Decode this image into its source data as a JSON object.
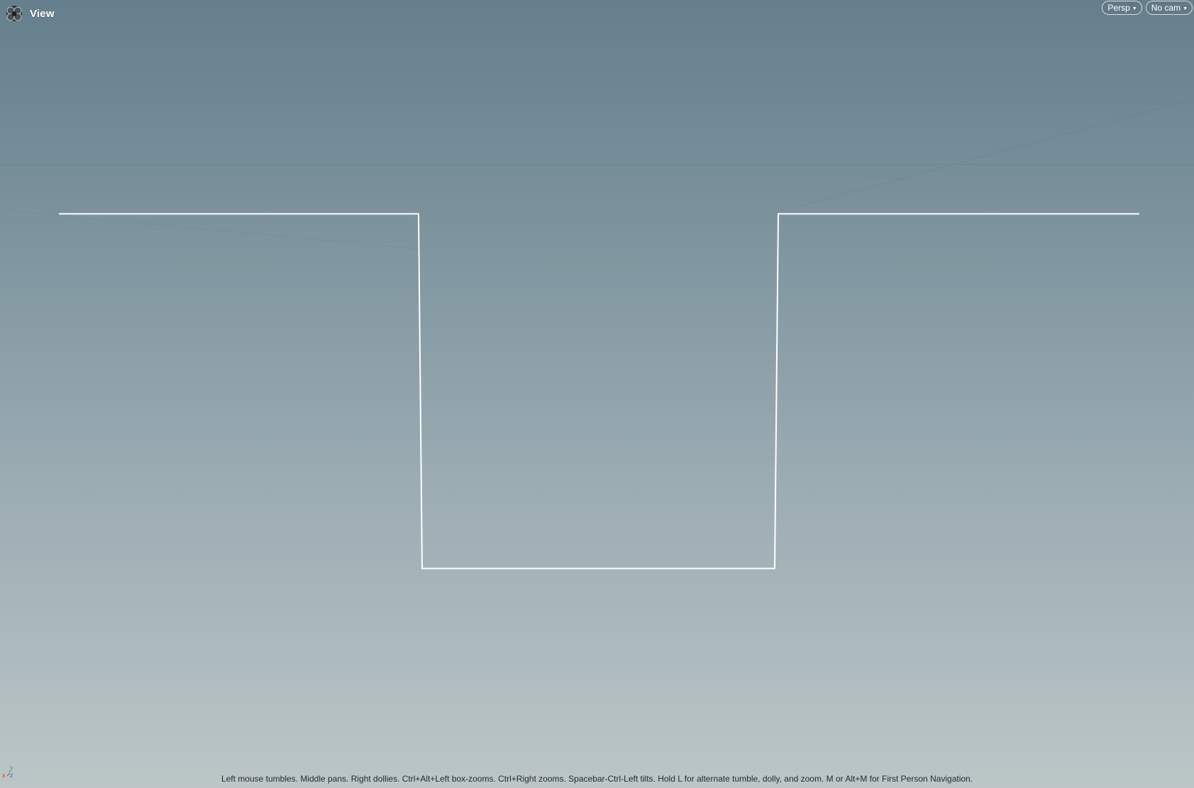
{
  "viewport": {
    "title": "View",
    "app_icon": "houdini-logo-icon",
    "camera_mode": {
      "label": "Persp",
      "icon": "dropdown-caret-icon"
    },
    "camera_select": {
      "label": "No cam",
      "icon": "dropdown-caret-icon"
    },
    "axis_labels": {
      "x": "x",
      "y": "y",
      "z": "z"
    },
    "axis_colors": {
      "x": "#d63a2a",
      "y": "#39b24a",
      "z": "#2f64d8"
    },
    "curve_color": "#ffffff",
    "hint": "Left mouse tumbles. Middle pans. Right dollies. Ctrl+Alt+Left box-zooms. Ctrl+Right zooms. Spacebar-Ctrl-Left tilts. Hold L for alternate tumble, dolly, and zoom. M or Alt+M for First Person Navigation."
  }
}
